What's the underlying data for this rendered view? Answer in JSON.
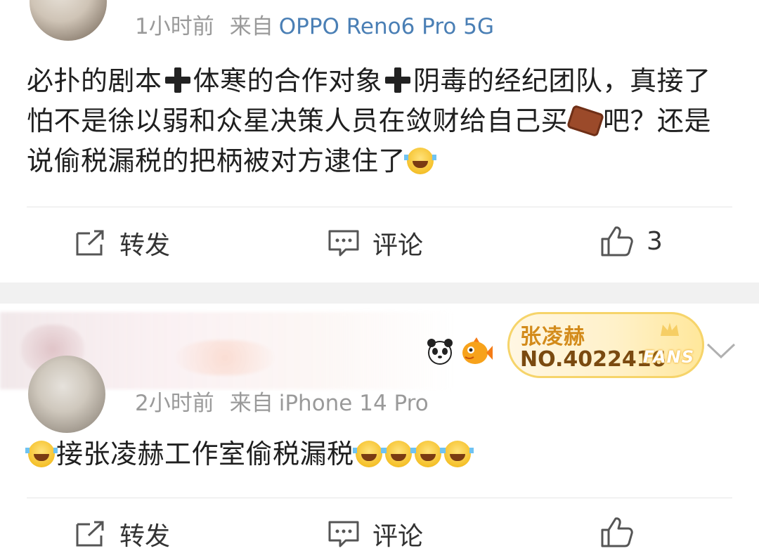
{
  "post1": {
    "time": "1小时前",
    "from_label": "来自",
    "device": "OPPO Reno6 Pro 5G",
    "content": [
      {
        "t": "text",
        "v": "必扑的剧本"
      },
      {
        "t": "emoji",
        "v": "plus"
      },
      {
        "t": "text",
        "v": "体寒的合作对象"
      },
      {
        "t": "emoji",
        "v": "plus"
      },
      {
        "t": "text",
        "v": "阴毒的经纪团队，真接了怕不是徐以弱和众星决策人员在敛财给自己买"
      },
      {
        "t": "emoji",
        "v": "coffin"
      },
      {
        "t": "text",
        "v": "吧？还是说偷税漏税的把柄被对方逮住了"
      },
      {
        "t": "emoji",
        "v": "laugh"
      }
    ],
    "actions": {
      "repost_label": "转发",
      "comment_label": "评论",
      "like_count": "3"
    }
  },
  "post2": {
    "time": "2小时前",
    "from_label": "来自",
    "device": "iPhone 14 Pro",
    "fans_badge": {
      "name": "张凌赫",
      "number": "NO.4022416",
      "word": "FANS"
    },
    "content": [
      {
        "t": "emoji",
        "v": "laugh"
      },
      {
        "t": "text",
        "v": "接张凌赫工作室偷税漏税"
      },
      {
        "t": "emoji",
        "v": "laugh"
      },
      {
        "t": "emoji",
        "v": "laugh"
      },
      {
        "t": "emoji",
        "v": "laugh"
      },
      {
        "t": "emoji",
        "v": "laugh"
      }
    ],
    "actions": {
      "repost_label": "转发",
      "comment_label": "评论"
    }
  },
  "icons": {
    "repost": "share-icon",
    "comment": "comment-icon",
    "like": "thumbs-up-icon",
    "expand": "chevron-down-icon"
  },
  "colors": {
    "device_link": "#4a7fb5",
    "muted": "#9a9a9a",
    "fans_text": "#d38b1b"
  }
}
